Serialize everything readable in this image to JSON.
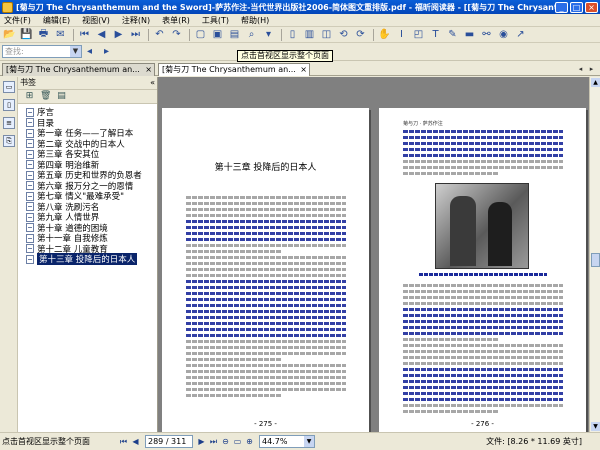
{
  "window": {
    "title": "[菊与刀 The Chrysanthemum and the Sword]-萨苏作注-当代世界出版社2006-简体图文重排版.pdf - 福昕阅读器 - [[菊与刀 The Chrysanthemum and the Sword]-萨苏作",
    "minimize": "_",
    "maximize": "□",
    "close": "×"
  },
  "menu": [
    "文件(F)",
    "编辑(E)",
    "视图(V)",
    "注释(N)",
    "表单(R)",
    "工具(T)",
    "帮助(H)"
  ],
  "toolbar": {
    "search_combo_text": "查找:",
    "tooltip": "点击首视区显示整个页面"
  },
  "tabs": [
    {
      "label": "[菊与刀 The Chrysanthemum an...",
      "close": "×"
    },
    {
      "label": "[菊与刀 The Chrysanthemum an...",
      "close": "×"
    }
  ],
  "sidebar": {
    "header": "书签",
    "collapse": "«",
    "items": [
      "序言",
      "目录",
      "第一章 任务——了解日本",
      "第二章 交战中的日本人",
      "第三章 各安其位",
      "第四章 明治维新",
      "第五章 历史和世界的负恩者",
      "第六章 报万分之一的恩情",
      "第七章 情义\"最难承受\"",
      "第八章 洗刷污名",
      "第九章 人情世界",
      "第十章 道德的困境",
      "第十一章 自我修炼",
      "第十二章 儿童教育",
      "第十三章 投降后的日本人"
    ],
    "selected_index": 14
  },
  "document": {
    "left_page": {
      "chapter_title": "第十三章 投降后的日本人",
      "page_number": "- 275 -"
    },
    "right_page": {
      "header": "菊与刀 · 萨苏作注",
      "page_number": "- 276 -"
    }
  },
  "statusbar": {
    "text": "点击首视区显示整个页面",
    "page_field": "289 / 311",
    "zoom": "44.7%",
    "size": "文件: [8.26 * 11.69 英寸]"
  }
}
